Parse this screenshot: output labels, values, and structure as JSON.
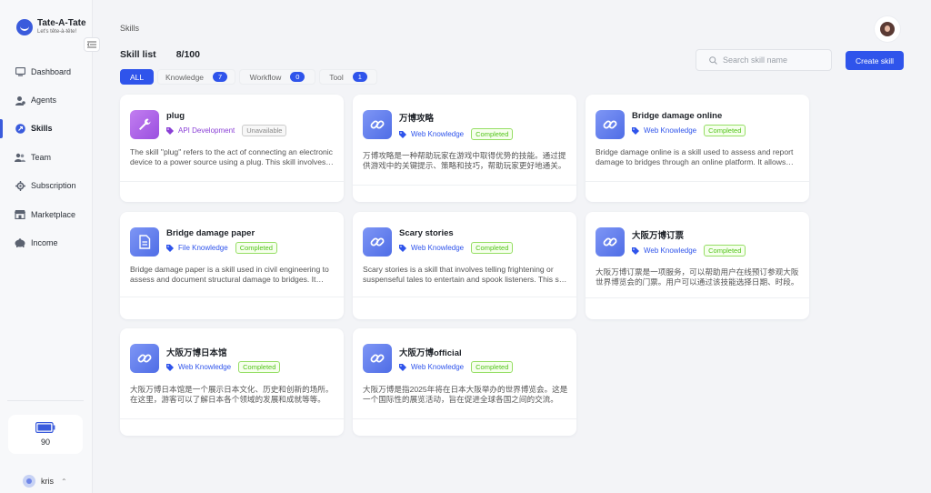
{
  "app": {
    "name": "Tate-A-Tate",
    "tagline": "Let's tête-à-tête!"
  },
  "sidebar": {
    "items": [
      {
        "label": "Dashboard",
        "icon": "dashboard-icon"
      },
      {
        "label": "Agents",
        "icon": "agents-icon"
      },
      {
        "label": "Skills",
        "icon": "skills-icon",
        "active": true
      },
      {
        "label": "Team",
        "icon": "team-icon"
      },
      {
        "label": "Subscription",
        "icon": "subscription-icon"
      },
      {
        "label": "Marketplace",
        "icon": "marketplace-icon"
      },
      {
        "label": "Income",
        "icon": "income-icon"
      }
    ],
    "credits": "90",
    "user": "kris"
  },
  "header": {
    "breadcrumb": "Skills",
    "list_title": "Skill list",
    "list_count": "8/100",
    "search_placeholder": "Search skill name",
    "create_label": "Create skill"
  },
  "tabs": [
    {
      "label": "ALL",
      "active": true
    },
    {
      "label": "Knowledge",
      "count": "7"
    },
    {
      "label": "Workflow",
      "count": "0"
    },
    {
      "label": "Tool",
      "count": "1"
    }
  ],
  "colors": {
    "accent": "#2f54eb",
    "completed": "#52c41a",
    "purple": "#8a3fd6"
  },
  "cards": [
    {
      "title": "plug",
      "type": "API Development",
      "status": "Unavailable",
      "icon": "wrench-icon",
      "desc": "The skill \"plug\" refers to the act of connecting an electronic device to a power source using a plug. This skill involves inserting the plug."
    },
    {
      "title": "万博攻略",
      "type": "Web Knowledge",
      "status": "Completed",
      "icon": "link-icon",
      "desc": "万博攻略是一种帮助玩家在游戏中取得优势的技能。通过提供游戏中的关键提示、策略和技巧，帮助玩家更好地通关。"
    },
    {
      "title": "Bridge damage online",
      "type": "Web Knowledge",
      "status": "Completed",
      "icon": "link-icon",
      "desc": "Bridge damage online is a skill used to assess and report damage to bridges through an online platform. It allows users to submit reports."
    },
    {
      "title": "Bridge damage paper",
      "type": "File Knowledge",
      "status": "Completed",
      "icon": "file-icon",
      "desc": "Bridge damage paper is a skill used in civil engineering to assess and document structural damage to bridges. It involves careful inspection."
    },
    {
      "title": "Scary stories",
      "type": "Web Knowledge",
      "status": "Completed",
      "icon": "link-icon",
      "desc": "Scary stories is a skill that involves telling frightening or suspenseful tales to entertain and spook listeners. This skill requires imagination."
    },
    {
      "title": "大阪万博订票",
      "type": "Web Knowledge",
      "status": "Completed",
      "icon": "link-icon",
      "desc": "大阪万博订票是一项服务，可以帮助用户在线预订参观大阪世界博览会的门票。用户可以通过该技能选择日期、时段。"
    },
    {
      "title": "大阪万博日本馆",
      "type": "Web Knowledge",
      "status": "Completed",
      "icon": "link-icon",
      "desc": "大阪万博日本馆是一个展示日本文化、历史和创新的场所。在这里，游客可以了解日本各个领域的发展和成就等等。"
    },
    {
      "title": "大阪万博official",
      "type": "Web Knowledge",
      "status": "Completed",
      "icon": "link-icon",
      "desc": "大阪万博是指2025年将在日本大阪举办的世界博览会。这是一个国际性的展览活动，旨在促进全球各国之间的交流。"
    }
  ]
}
